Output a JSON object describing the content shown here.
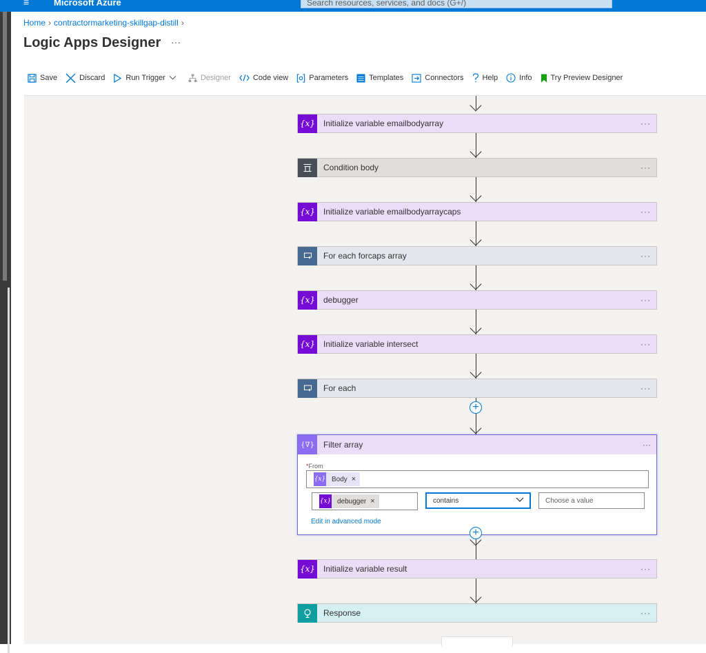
{
  "topbar": {
    "menu_glyph": "≡",
    "brand": "Microsoft Azure",
    "search_placeholder": "Search resources, services, and docs (G+/)"
  },
  "breadcrumb": {
    "home": "Home",
    "resource": "contractormarketing-skillgap-distill"
  },
  "page": {
    "title": "Logic Apps Designer",
    "more": "···"
  },
  "toolbar": {
    "save": "Save",
    "discard": "Discard",
    "run_trigger": "Run Trigger",
    "designer": "Designer",
    "code_view": "Code view",
    "parameters": "Parameters",
    "templates": "Templates",
    "connectors": "Connectors",
    "help": "Help",
    "info": "Info",
    "preview": "Try Preview Designer"
  },
  "steps": [
    {
      "label": "Initialize variable emailbodyarray",
      "icon": "variable-icon"
    },
    {
      "label": "Condition body",
      "icon": "condition-icon"
    },
    {
      "label": "Initialize variable emailbodyarraycaps",
      "icon": "variable-icon"
    },
    {
      "label": "For each forcaps array",
      "icon": "foreach-icon"
    },
    {
      "label": "debugger",
      "icon": "variable-icon"
    },
    {
      "label": "Initialize variable intersect",
      "icon": "variable-icon"
    },
    {
      "label": "For each",
      "icon": "foreach-icon"
    },
    {
      "label": "Initialize variable result",
      "icon": "variable-icon"
    },
    {
      "label": "Response",
      "icon": "response-icon"
    }
  ],
  "filter": {
    "title": "Filter array",
    "from_label": "From",
    "from_token": "Body",
    "left_token": "debugger",
    "operator": "contains",
    "value_placeholder": "Choose a value",
    "advanced_link": "Edit in advanced mode"
  },
  "glyphs": {
    "more": "···",
    "var": "{x}",
    "close": "×"
  },
  "colors": {
    "azure_blue": "#0078d4",
    "variable": "#770bd6",
    "variable_bg": "#ebddf8",
    "condition": "#484f58",
    "foreach": "#486991",
    "response": "#0f9ea0"
  }
}
